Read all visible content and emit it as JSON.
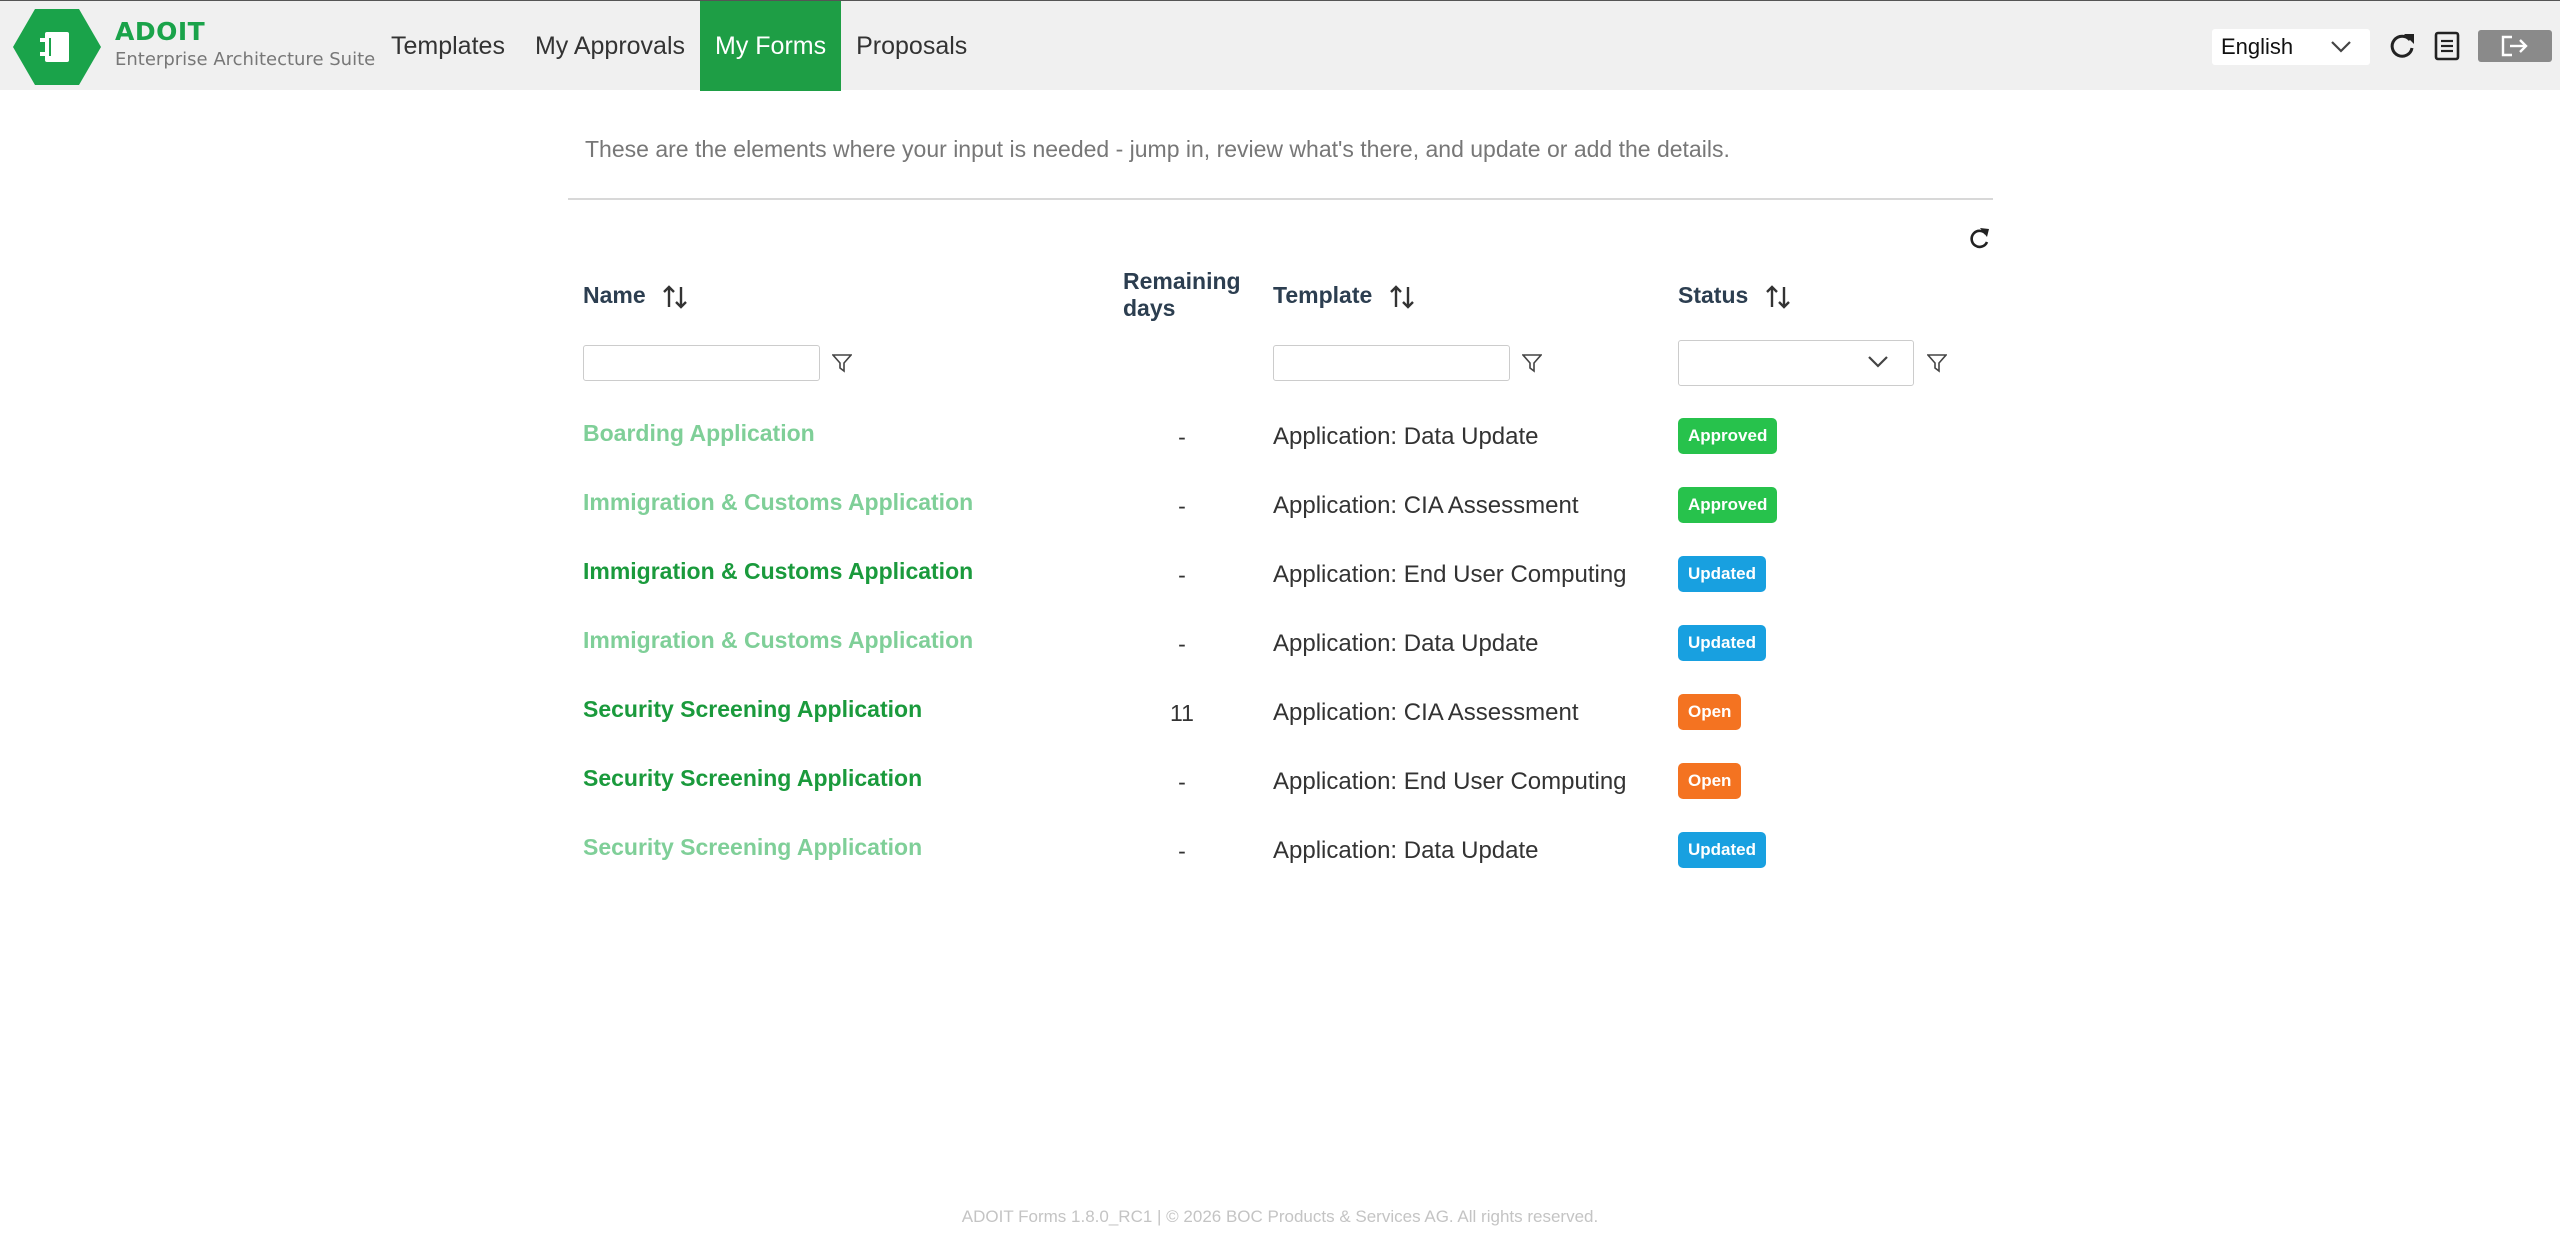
{
  "brand": {
    "name": "ADOIT",
    "subtitle": "Enterprise Architecture Suite"
  },
  "nav": {
    "templates": "Templates",
    "approvals": "My Approvals",
    "forms": "My Forms",
    "proposals": "Proposals"
  },
  "header": {
    "language": "English",
    "language_icon": "chevron-down-icon",
    "icons": [
      "refresh-icon",
      "document-icon",
      "logout-icon"
    ]
  },
  "intro": "These are the elements where your input is needed - jump in, review what's there, and update or add the details.",
  "table": {
    "columns": {
      "name": "Name",
      "remaining_line1": "Remaining",
      "remaining_line2": "days",
      "template": "Template",
      "status": "Status"
    },
    "rows": [
      {
        "name": "Boarding Application",
        "days": "-",
        "template": "Application: Data Update",
        "status": "Approved"
      },
      {
        "name": "Immigration & Customs Application",
        "days": "-",
        "template": "Application: CIA Assessment",
        "status": "Approved"
      },
      {
        "name": "Immigration & Customs Application",
        "days": "-",
        "template": "Application: End User Computing",
        "status": "Updated"
      },
      {
        "name": "Immigration & Customs Application",
        "days": "-",
        "template": "Application: Data Update",
        "status": "Updated"
      },
      {
        "name": "Security Screening Application",
        "days": "11",
        "template": "Application: CIA Assessment",
        "status": "Open"
      },
      {
        "name": "Security Screening Application",
        "days": "-",
        "template": "Application: End User Computing",
        "status": "Open"
      },
      {
        "name": "Security Screening Application",
        "days": "-",
        "template": "Application: Data Update",
        "status": "Updated"
      }
    ]
  },
  "colors": {
    "brand": "#1aa34a",
    "nav_active": "#1e9e45",
    "link_dark": "#1a9a3c",
    "link_light": "#7fcf98",
    "approved": "#27c24c",
    "updated": "#18a0e0",
    "open": "#f47321"
  },
  "footer": "ADOIT Forms 1.8.0_RC1 | © 2026 BOC Products & Services AG. All rights reserved."
}
